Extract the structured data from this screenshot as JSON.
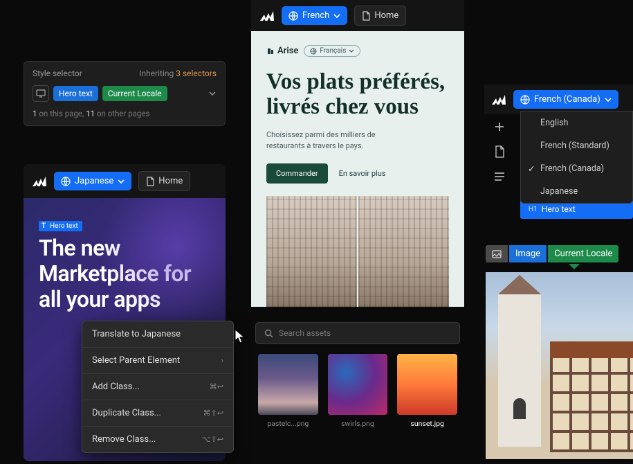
{
  "style_selector": {
    "title": "Style selector",
    "inheriting_label": "Inheriting",
    "inheriting_count": "3 selectors",
    "tag_primary": "Hero text",
    "tag_locale": "Current Locale",
    "footer_n1": "1",
    "footer_t1": " on this page, ",
    "footer_n2": "11",
    "footer_t2": " on other pages"
  },
  "panel_a": {
    "lang": "Japanese",
    "home": "Home",
    "hero_label": "Hero text",
    "hero_text": "The new Marketplace for all your apps"
  },
  "context_menu": {
    "items": [
      {
        "label": "Translate to Japanese",
        "kb": ""
      },
      {
        "label": "Select Parent Element",
        "kb": "›"
      },
      {
        "label": "Add Class...",
        "kb": "⌘↩"
      },
      {
        "label": "Duplicate Class...",
        "kb": "⌘⇧↩"
      },
      {
        "label": "Remove Class...",
        "kb": "⌥⇧↩"
      }
    ]
  },
  "panel_b": {
    "lang": "French",
    "home": "Home",
    "brand": "Arise",
    "pill": "Français",
    "title": "Vos plats préférés, livrés chez vous",
    "sub": "Choisissez parmi des milliers de restaurants à travers le pays.",
    "btn_primary": "Commander",
    "btn_link": "En savoir plus"
  },
  "assets": {
    "search_placeholder": "Search assets",
    "items": [
      {
        "caption": "pastelc...png"
      },
      {
        "caption": "swirls.png"
      },
      {
        "caption": "sunset.jpg"
      }
    ]
  },
  "panel_c": {
    "lang": "French (Canada)",
    "options": [
      "English",
      "French (Standard)",
      "French (Canada)",
      "Japanese"
    ],
    "selected_index": 2,
    "hero_h1": "H1",
    "hero_label": "Hero text"
  },
  "panel_d": {
    "badge_image": "Image",
    "badge_locale": "Current Locale"
  }
}
